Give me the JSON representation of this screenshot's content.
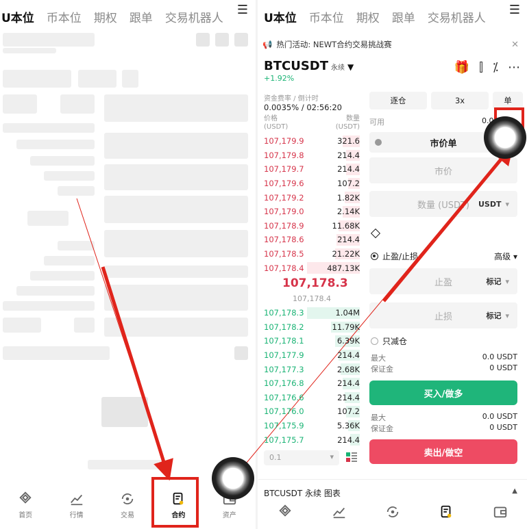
{
  "tabs": [
    "U本位",
    "币本位",
    "期权",
    "跟单",
    "交易机器人"
  ],
  "menu_icon": "hamburger-menu-icon",
  "left": {
    "nav": [
      {
        "label": "首页",
        "icon": "home-icon"
      },
      {
        "label": "行情",
        "icon": "market-chart-icon"
      },
      {
        "label": "交易",
        "icon": "trade-exchange-icon"
      },
      {
        "label": "合约",
        "icon": "futures-contract-icon",
        "active": true
      },
      {
        "label": "资产",
        "icon": "wallet-icon"
      }
    ]
  },
  "right": {
    "banner_text": "热门活动: NEWT合约交易挑战赛",
    "pair": "BTCUSDT",
    "pair_type": "永续",
    "change": "+1.92%",
    "funding_label": "资金费率 / 倒计时",
    "funding_value": "0.0035% / 02:56:20",
    "ob_price_label": "价格",
    "ob_price_unit": "(USDT)",
    "ob_qty_label": "数量",
    "ob_qty_unit": "(USDT)",
    "asks": [
      {
        "price": "107,179.9",
        "qty": "321.6",
        "depth": 0.18
      },
      {
        "price": "107,179.8",
        "qty": "214.4",
        "depth": 0.14
      },
      {
        "price": "107,179.7",
        "qty": "214.4",
        "depth": 0.14
      },
      {
        "price": "107,179.6",
        "qty": "107.2",
        "depth": 0.12
      },
      {
        "price": "107,179.2",
        "qty": "1.82K",
        "depth": 0.16
      },
      {
        "price": "107,179.0",
        "qty": "2.14K",
        "depth": 0.18
      },
      {
        "price": "107,178.9",
        "qty": "11.68K",
        "depth": 0.22
      },
      {
        "price": "107,178.6",
        "qty": "214.4",
        "depth": 0.24
      },
      {
        "price": "107,178.5",
        "qty": "21.22K",
        "depth": 0.26
      },
      {
        "price": "107,178.4",
        "qty": "487.13K",
        "depth": 0.55
      }
    ],
    "mid_price": "107,178.3",
    "mark_price": "107,178.4",
    "bids": [
      {
        "price": "107,178.3",
        "qty": "1.04M",
        "depth": 0.55
      },
      {
        "price": "107,178.2",
        "qty": "11.79K",
        "depth": 0.3
      },
      {
        "price": "107,178.1",
        "qty": "6.39K",
        "depth": 0.26
      },
      {
        "price": "107,177.9",
        "qty": "214.4",
        "depth": 0.22
      },
      {
        "price": "107,177.3",
        "qty": "2.68K",
        "depth": 0.2
      },
      {
        "price": "107,176.8",
        "qty": "214.4",
        "depth": 0.18
      },
      {
        "price": "107,176.6",
        "qty": "214.4",
        "depth": 0.16
      },
      {
        "price": "107,176.0",
        "qty": "107.2",
        "depth": 0.14
      },
      {
        "price": "107,175.9",
        "qty": "5.36K",
        "depth": 0.12
      },
      {
        "price": "107,175.7",
        "qty": "214.4",
        "depth": 0.1
      }
    ],
    "depth_value": "0.1",
    "margin_mode": "逐仓",
    "leverage": "3x",
    "position_mode": "单",
    "available_label": "可用",
    "available_value": "0.00 U",
    "order_type": "市价单",
    "price_placeholder": "市价",
    "qty_placeholder": "数量 (USDT)",
    "qty_unit": "USDT",
    "tpsl_label": "止盈/止损",
    "advanced_label": "高级",
    "tp_placeholder": "止盈",
    "sl_placeholder": "止损",
    "trigger_label": "标记",
    "reduce_only": "只减仓",
    "max_label": "最大",
    "margin_label": "保证金",
    "buy_max": "0.0 USDT",
    "buy_margin": "0 USDT",
    "sell_max": "0.0 USDT",
    "sell_margin": "0 USDT",
    "buy_label": "买入/做多",
    "sell_label": "卖出/做空",
    "chart_label": "BTCUSDT 永续  图表"
  },
  "colors": {
    "ask": "#d6344a",
    "bid": "#19b374",
    "buy_button": "#1fb57a",
    "sell_button": "#ee4b63",
    "annotation": "#e0241b"
  }
}
